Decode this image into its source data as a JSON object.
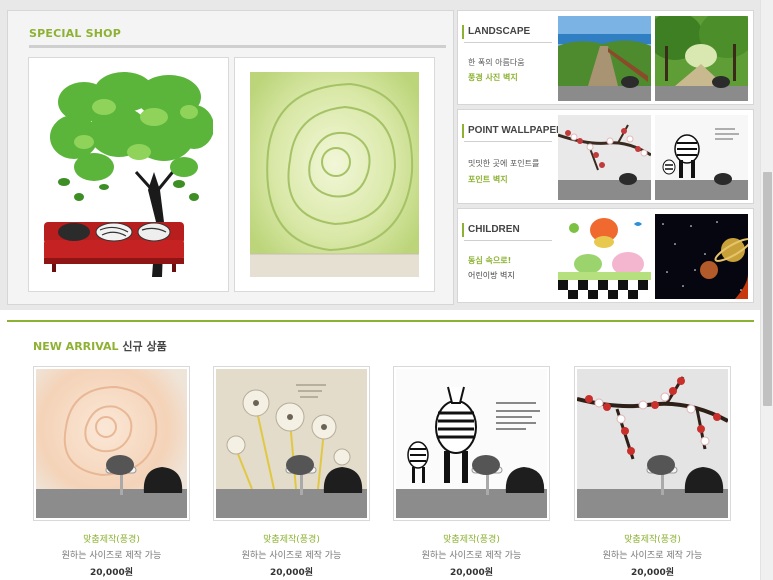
{
  "special_shop": {
    "title": "SPECIAL SHOP",
    "cards": [
      {
        "icon": "tree-sofa-wallpaper"
      },
      {
        "icon": "green-rose-wallpaper"
      }
    ]
  },
  "categories": [
    {
      "title": "LANDSCAPE",
      "line1": "한 폭의 아름다움",
      "line2": "풍경 사진 벽지",
      "line2_color": "#8db233",
      "line1_color": "#555555"
    },
    {
      "title": "POINT WALLPAPER",
      "line1": "밋밋한 곳에 포인트를",
      "line2": "포인트 벽지",
      "line2_color": "#8db233",
      "line1_color": "#555555"
    },
    {
      "title": "CHILDREN",
      "line1": "동심 속으로!",
      "line2": "어린이방 벽지",
      "line1_color": "#8db233",
      "line2_color": "#444444"
    }
  ],
  "new_arrival": {
    "title_en": "NEW ARRIVAL",
    "title_kr": "신규 상품",
    "products": [
      {
        "name": "맞춤제작(풍경)",
        "desc": "원하는 사이즈로 제작 가능",
        "price": "20,000원",
        "icon": "peach-rose-icon"
      },
      {
        "name": "맞춤제작(풍경)",
        "desc": "원하는 사이즈로 제작 가능",
        "price": "20,000원",
        "icon": "dandelion-icon"
      },
      {
        "name": "맞춤제작(풍경)",
        "desc": "원하는 사이즈로 제작 가능",
        "price": "20,000원",
        "icon": "zebra-icon"
      },
      {
        "name": "맞춤제작(풍경)",
        "desc": "원하는 사이즈로 제작 가능",
        "price": "20,000원",
        "icon": "plum-blossom-icon"
      }
    ]
  },
  "colors": {
    "accent": "#8db233",
    "text_dark": "#444444",
    "text_muted": "#777777"
  }
}
